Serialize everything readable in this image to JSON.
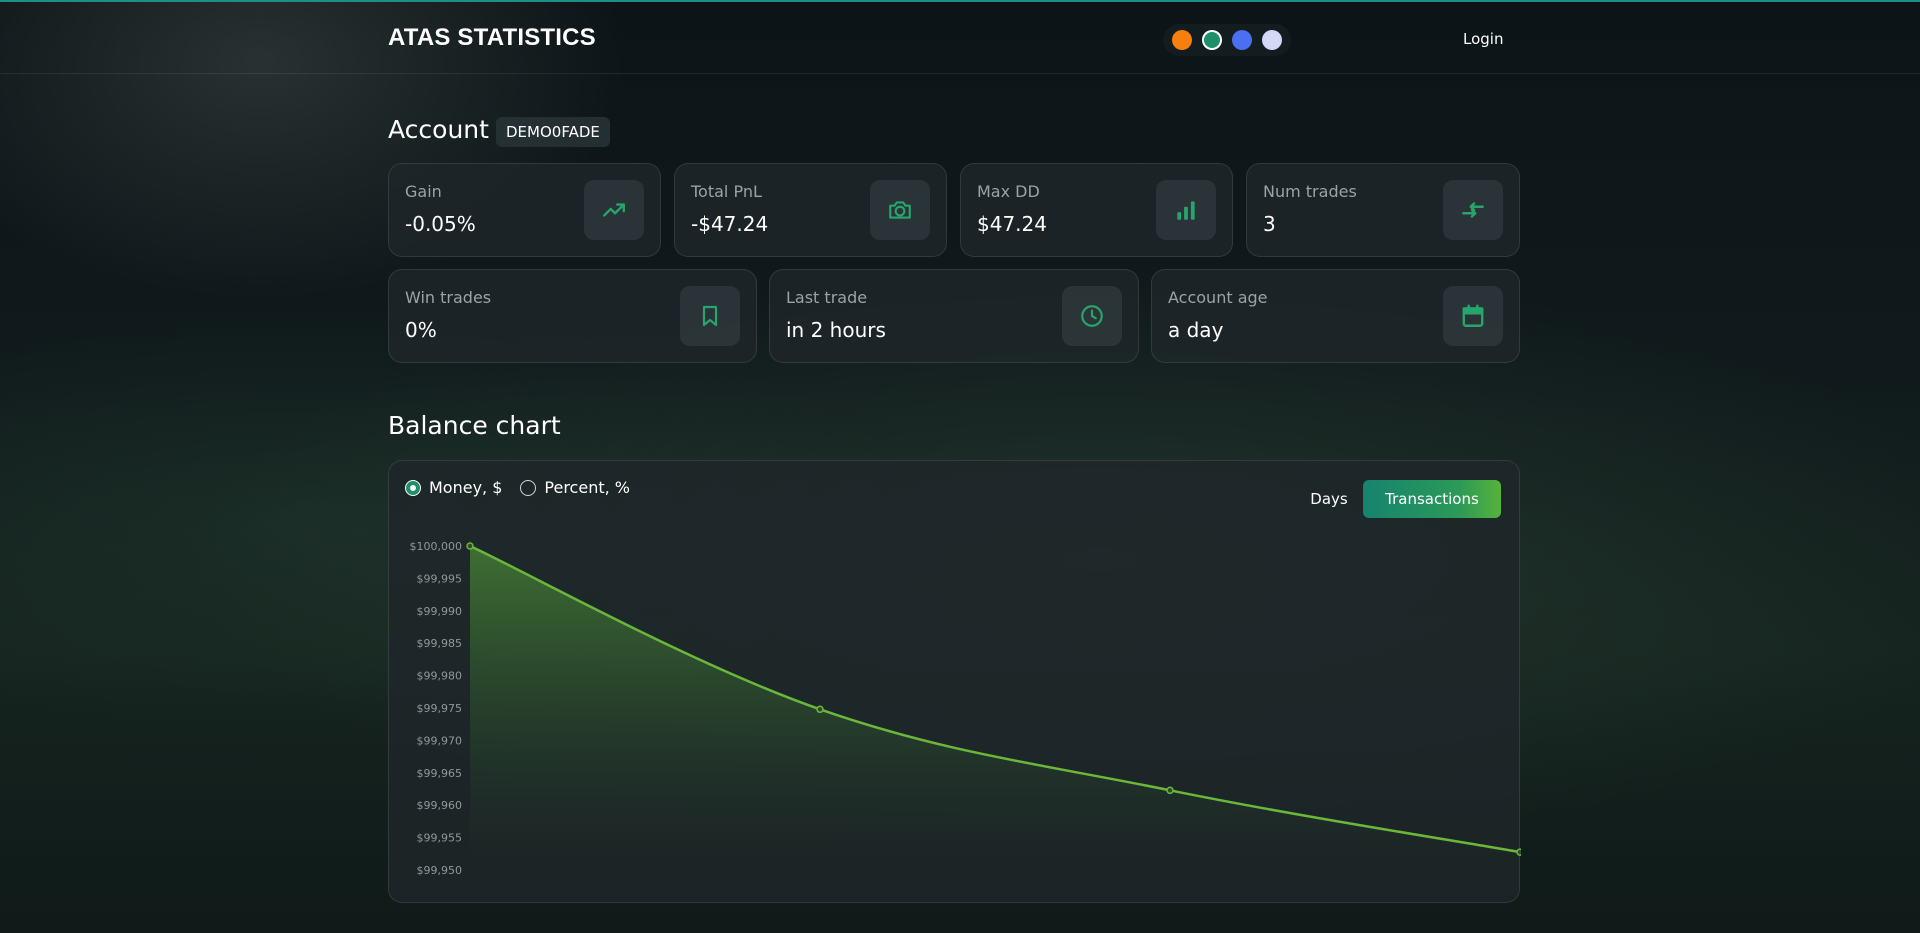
{
  "header": {
    "brand": "ATAS STATISTICS",
    "themes": [
      {
        "name": "orange",
        "color": "#f77f0f"
      },
      {
        "name": "teal",
        "color": "#1f8f6a"
      },
      {
        "name": "blue",
        "color": "#4b6ff0"
      },
      {
        "name": "lavender",
        "color": "#d3d8f5"
      }
    ],
    "active_theme": "teal",
    "login_label": "Login"
  },
  "account": {
    "title": "Account",
    "id": "DEMO0FADE"
  },
  "stats": {
    "gain": {
      "label": "Gain",
      "value": "-0.05%",
      "icon": "trending-up-icon"
    },
    "total_pnl": {
      "label": "Total PnL",
      "value": "-$47.24",
      "icon": "camera-icon"
    },
    "max_dd": {
      "label": "Max DD",
      "value": "$47.24",
      "icon": "bar-chart-icon"
    },
    "num_trades": {
      "label": "Num trades",
      "value": "3",
      "icon": "arrows-exchange-icon"
    },
    "win_trades": {
      "label": "Win trades",
      "value": "0%",
      "icon": "bookmark-icon"
    },
    "last_trade": {
      "label": "Last trade",
      "value": "in 2 hours",
      "icon": "clock-icon"
    },
    "account_age": {
      "label": "Account age",
      "value": "a day",
      "icon": "calendar-icon"
    }
  },
  "balance_chart": {
    "title": "Balance chart",
    "mode_options": [
      {
        "label": "Money, $",
        "checked": true
      },
      {
        "label": "Percent, %",
        "checked": false
      }
    ],
    "days_label": "Days",
    "transactions_label": "Transactions"
  },
  "colors": {
    "accent": "#1f8f6a",
    "line": "#6ab83a",
    "panel": "#1e262a"
  },
  "chart_data": {
    "type": "area",
    "x": [
      0,
      1,
      2,
      3
    ],
    "series": [
      {
        "values": [
          100000,
          99974.8,
          99962.3,
          99952.76
        ]
      }
    ],
    "ylim": [
      99950,
      100000
    ],
    "yticks": [
      100000,
      99995,
      99990,
      99985,
      99980,
      99975,
      99970,
      99965,
      99960,
      99955,
      99950
    ],
    "ytick_labels": [
      "$100,000",
      "$99,995",
      "$99,990",
      "$99,985",
      "$99,980",
      "$99,975",
      "$99,970",
      "$99,965",
      "$99,960",
      "$99,955",
      "$99,950"
    ],
    "grid": false
  }
}
